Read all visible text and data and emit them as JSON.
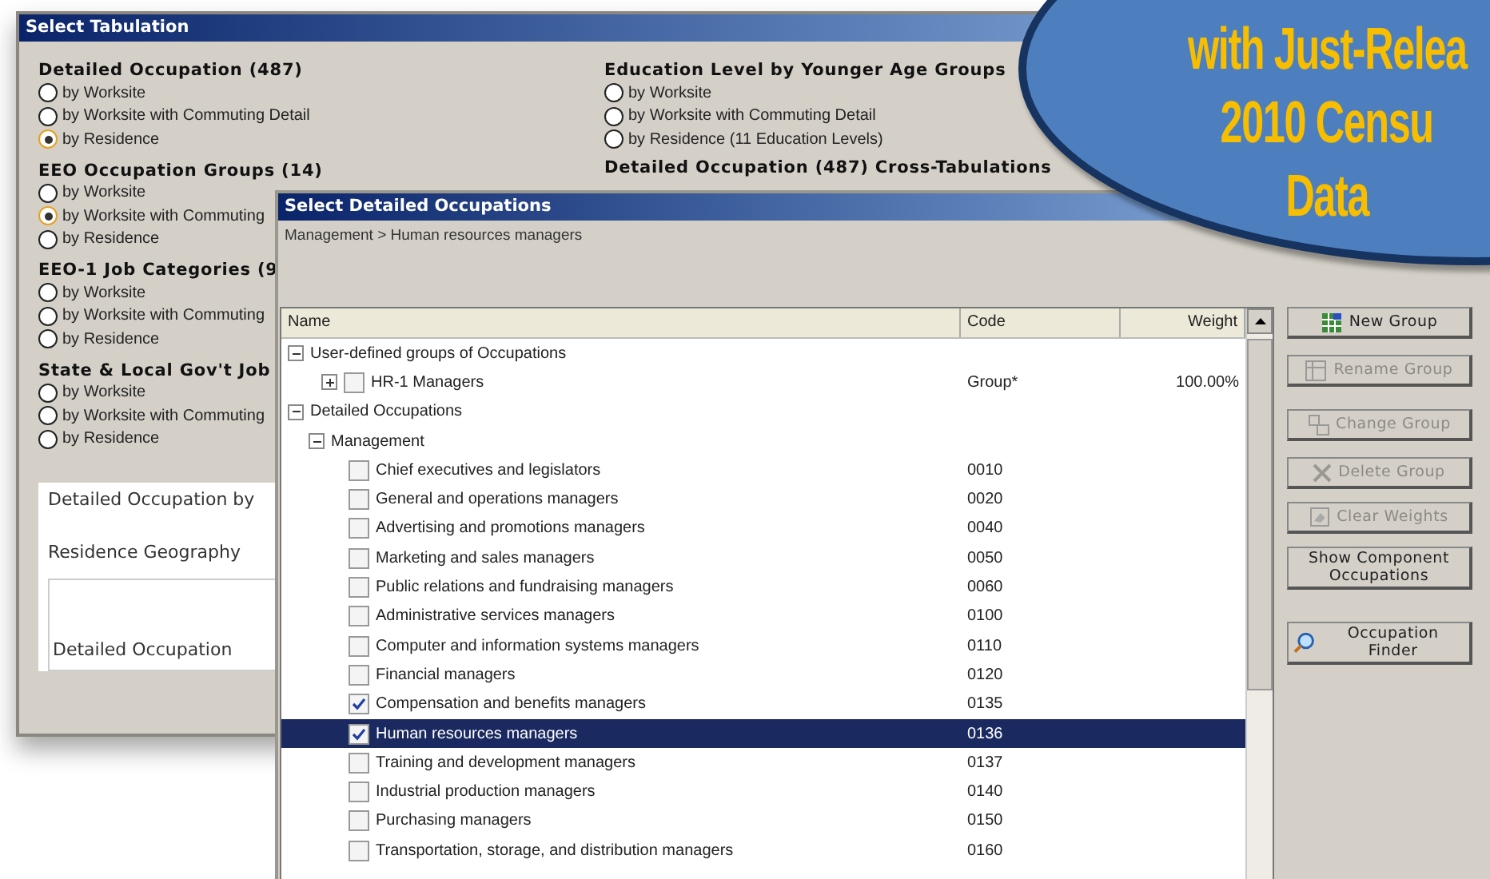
{
  "tabulation_window": {
    "title": "Select Tabulation",
    "groups": [
      {
        "heading": "Detailed Occupation (487)",
        "options": [
          {
            "label": "by Worksite",
            "selected": false
          },
          {
            "label": "by Worksite with Commuting Detail",
            "selected": false
          },
          {
            "label": "by Residence",
            "selected": true
          }
        ]
      },
      {
        "heading": "EEO Occupation Groups (14)",
        "options": [
          {
            "label": "by Worksite",
            "selected": false
          },
          {
            "label": "by Worksite with Commuting",
            "selected": true
          },
          {
            "label": "by Residence",
            "selected": false
          }
        ]
      },
      {
        "heading": "EEO-1 Job Categories (9",
        "options": [
          {
            "label": "by Worksite",
            "selected": false
          },
          {
            "label": "by Worksite with Commuting",
            "selected": false
          },
          {
            "label": "by Residence",
            "selected": false
          }
        ]
      },
      {
        "heading": "State & Local Gov't Job",
        "options": [
          {
            "label": "by Worksite",
            "selected": false
          },
          {
            "label": "by Worksite with Commuting",
            "selected": false
          },
          {
            "label": "by Residence",
            "selected": false
          }
        ]
      }
    ],
    "right_groups": [
      {
        "heading": "Education Level by Younger Age Groups",
        "options": [
          {
            "label": "by Worksite",
            "selected": false
          },
          {
            "label": "by Worksite with Commuting Detail",
            "selected": false
          },
          {
            "label": "by Residence (11 Education Levels)",
            "selected": false
          }
        ]
      }
    ],
    "cross_tab_heading": "Detailed Occupation (487) Cross-Tabulations",
    "preview": {
      "title": "Detailed Occupation by",
      "row_label": "Residence Geography",
      "column_label": "Detailed Occupation"
    }
  },
  "occupations_window": {
    "title": "Select Detailed Occupations",
    "breadcrumb": "Management > Human resources managers",
    "columns": [
      "Name",
      "Code",
      "Weight"
    ],
    "tree": [
      {
        "kind": "category",
        "label": "User-defined groups of Occupations",
        "expanded": true,
        "children": [
          {
            "kind": "group",
            "label": "HR-1 Managers",
            "expanded": false,
            "checked": false,
            "code": "Group*",
            "weight": "100.00%"
          }
        ]
      },
      {
        "kind": "category",
        "label": "Detailed Occupations",
        "expanded": true,
        "children": [
          {
            "kind": "category",
            "label": "Management",
            "expanded": true,
            "children": [
              {
                "kind": "item",
                "label": "Chief executives and legislators",
                "code": "0010",
                "checked": false,
                "selected": false
              },
              {
                "kind": "item",
                "label": "General and operations managers",
                "code": "0020",
                "checked": false,
                "selected": false
              },
              {
                "kind": "item",
                "label": "Advertising and promotions managers",
                "code": "0040",
                "checked": false,
                "selected": false
              },
              {
                "kind": "item",
                "label": "Marketing and sales managers",
                "code": "0050",
                "checked": false,
                "selected": false
              },
              {
                "kind": "item",
                "label": "Public relations and fundraising managers",
                "code": "0060",
                "checked": false,
                "selected": false
              },
              {
                "kind": "item",
                "label": "Administrative services managers",
                "code": "0100",
                "checked": false,
                "selected": false
              },
              {
                "kind": "item",
                "label": "Computer and information systems managers",
                "code": "0110",
                "checked": false,
                "selected": false
              },
              {
                "kind": "item",
                "label": "Financial managers",
                "code": "0120",
                "checked": false,
                "selected": false
              },
              {
                "kind": "item",
                "label": "Compensation and benefits managers",
                "code": "0135",
                "checked": true,
                "selected": false
              },
              {
                "kind": "item",
                "label": "Human resources managers",
                "code": "0136",
                "checked": true,
                "selected": true
              },
              {
                "kind": "item",
                "label": "Training and development managers",
                "code": "0137",
                "checked": false,
                "selected": false
              },
              {
                "kind": "item",
                "label": "Industrial production managers",
                "code": "0140",
                "checked": false,
                "selected": false
              },
              {
                "kind": "item",
                "label": "Purchasing managers",
                "code": "0150",
                "checked": false,
                "selected": false
              },
              {
                "kind": "item",
                "label": "Transportation, storage, and distribution managers",
                "code": "0160",
                "checked": false,
                "selected": false
              }
            ]
          }
        ]
      }
    ],
    "buttons": [
      {
        "kind": "new",
        "label": "New Group",
        "disabled": false
      },
      {
        "kind": "rename",
        "label": "Rename Group",
        "disabled": true
      },
      {
        "kind": "change",
        "label": "Change Group",
        "disabled": true
      },
      {
        "kind": "delete",
        "label": "Delete Group",
        "disabled": true
      },
      {
        "kind": "clear",
        "label": "Clear Weights",
        "disabled": true
      },
      {
        "kind": "show",
        "label": "Show Component Occupations",
        "disabled": false
      },
      {
        "kind": "finder",
        "label": "Occupation Finder",
        "disabled": false
      }
    ]
  },
  "badge": {
    "lines": [
      "with Just-Relea",
      "2010 Censu",
      "Data"
    ]
  }
}
